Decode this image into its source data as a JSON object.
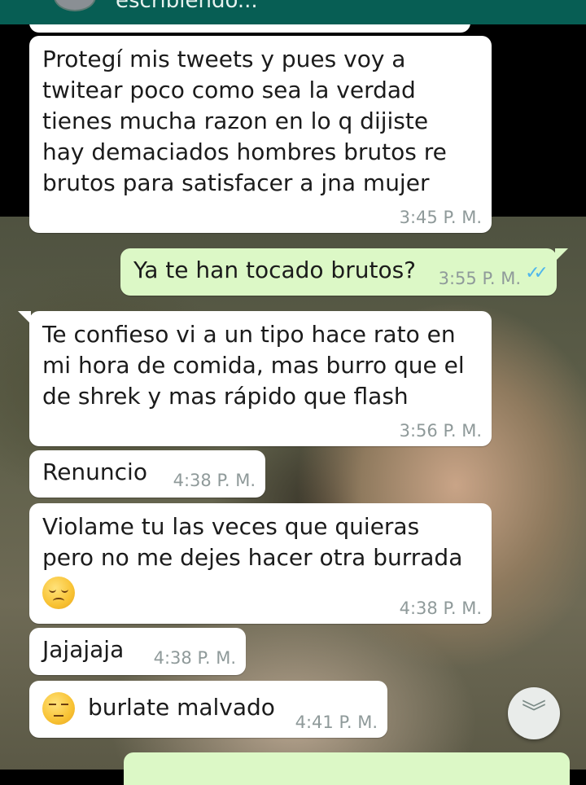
{
  "header": {
    "status": "escribiendo..."
  },
  "messages": [
    {
      "direction": "in",
      "lines": [
        "Protegí mis tweets y pues voy a",
        "twitear poco como sea la verdad",
        "tienes mucha razon en lo q dijiste",
        "hay demaciados hombres brutos re",
        "brutos para satisfacer a jna mujer"
      ],
      "time": "3:45 P. M."
    },
    {
      "direction": "out",
      "text": "Ya te han tocado brutos?",
      "time": "3:55 P. M.",
      "status_icon": "double-check-read-icon"
    },
    {
      "direction": "in",
      "lines": [
        "Te confieso vi a un tipo hace rato en",
        "mi hora de comida, mas burro que el",
        "de shrek y mas rápido que flash"
      ],
      "time": "3:56 P. M."
    },
    {
      "direction": "in",
      "text": "Renuncio",
      "time": "4:38 P. M."
    },
    {
      "direction": "in",
      "lines": [
        "Violame tu las veces que quieras",
        "pero no me dejes hacer otra burrada"
      ],
      "emoji": "pensive-face-emoji",
      "time": "4:38 P. M."
    },
    {
      "direction": "in",
      "text": "Jajajaja",
      "time": "4:38 P. M."
    },
    {
      "direction": "in",
      "emoji": "unamused-face-emoji",
      "text": "burlate malvado",
      "time": "4:41 P. M."
    }
  ],
  "scroll_button": {
    "icon": "double-chevron-down-icon",
    "glyph": "︾"
  },
  "colors": {
    "header": "#075e54",
    "incoming_bubble": "#ffffff",
    "outgoing_bubble": "#dcf8c6",
    "read_ticks": "#4fb6ec",
    "timestamp": "#8f9a9a"
  }
}
